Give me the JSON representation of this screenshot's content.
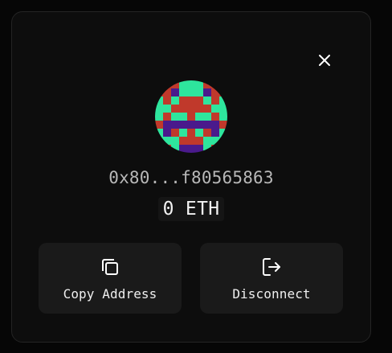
{
  "account": {
    "address": "0x80...f80565863",
    "balance": "0 ETH"
  },
  "icons": {
    "close": "close-icon",
    "avatar": "identicon-avatar",
    "copy": "copy-icon",
    "disconnect": "disconnect-icon"
  },
  "actions": {
    "copy_label": "Copy Address",
    "disconnect_label": "Disconnect"
  },
  "colors": {
    "background": "#0d0d0d",
    "button_bg": "#1a1a1a",
    "identicon_red": "#c0392b",
    "identicon_green": "#2ee59d",
    "identicon_purple": "#4a1a8c"
  }
}
